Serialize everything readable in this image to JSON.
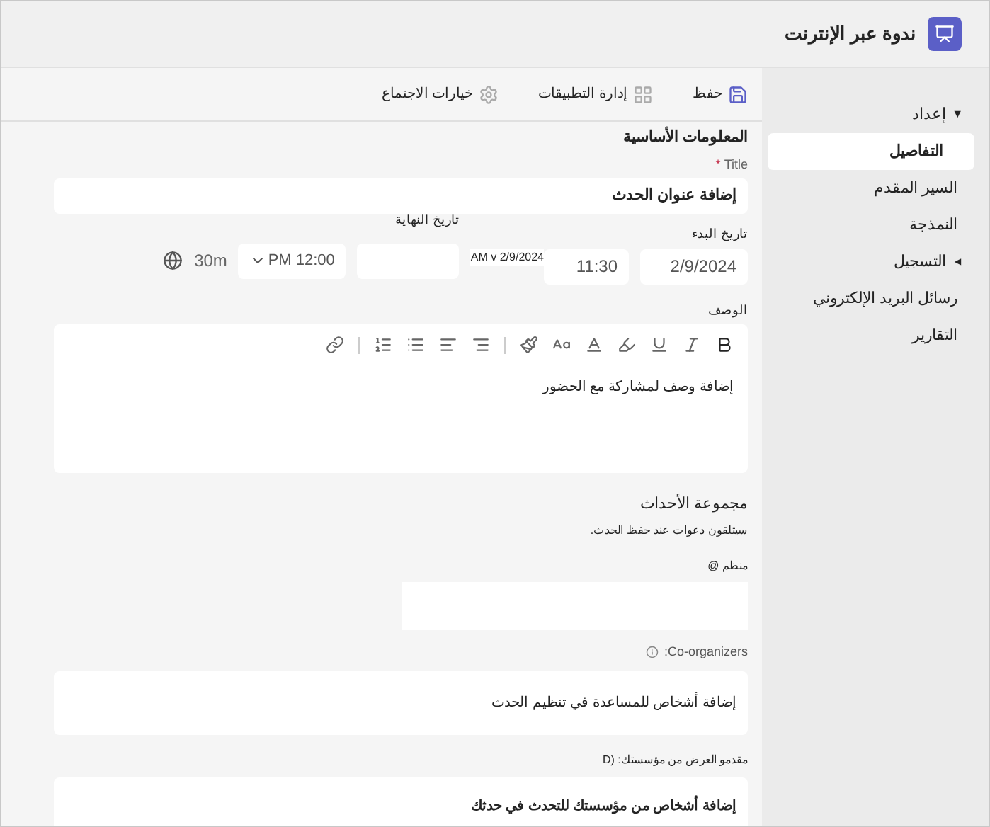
{
  "header": {
    "title": "ندوة عبر الإنترنت"
  },
  "sidebar": {
    "items": [
      {
        "label": "إعداد",
        "kind": "group",
        "caret": "▼",
        "expanded": true,
        "selected": false
      },
      {
        "label": "التفاصيل",
        "kind": "item",
        "selected": true
      },
      {
        "label": "السير المقدم",
        "kind": "item",
        "selected": false
      },
      {
        "label": "النمذجة",
        "kind": "item",
        "selected": false
      },
      {
        "label": "التسجيل",
        "kind": "group",
        "caret": "▼",
        "expanded": false,
        "selected": false
      },
      {
        "label": "رسائل البريد الإلكتروني",
        "kind": "item",
        "selected": false
      },
      {
        "label": "التقارير",
        "kind": "item",
        "selected": false
      }
    ]
  },
  "toolbar": [
    {
      "label": "حفظ",
      "kind": "save"
    },
    {
      "label": "إدارة التطبيقات",
      "kind": "apps"
    },
    {
      "label": "خيارات الاجتماع",
      "kind": "settings"
    }
  ],
  "section_title": "المعلومات الأساسية",
  "title_field": {
    "label": "Title",
    "required_mark": "*",
    "value": "إضافة عنوان الحدث"
  },
  "start": {
    "label": "تاريخ البدء",
    "date": "2/9/2024",
    "time": "11:30",
    "overlay": "AM v 2/9/2024"
  },
  "end": {
    "label": "تاريخ النهاية",
    "time": "12:00 PM",
    "duration": "30m"
  },
  "description": {
    "label": "الوصف",
    "placeholder": "إضافة وصف لمشاركة مع الحضور",
    "tools": [
      {
        "kind": "bold"
      },
      {
        "kind": "italic"
      },
      {
        "kind": "underline"
      },
      {
        "kind": "highlight"
      },
      {
        "kind": "font-color"
      },
      {
        "kind": "font-size"
      },
      {
        "kind": "style"
      },
      {
        "kind": "sep"
      },
      {
        "kind": "align-right"
      },
      {
        "kind": "align-left"
      },
      {
        "kind": "bullets"
      },
      {
        "kind": "numbers"
      },
      {
        "kind": "sep"
      },
      {
        "kind": "link"
      }
    ]
  },
  "group": {
    "title": "مجموعة الأحداث",
    "note": "سيتلقون دعوات عند حفظ الحدث."
  },
  "organizer": {
    "label": "منظم @"
  },
  "coorganizers": {
    "label": "Co-organizers:",
    "placeholder": "إضافة أشخاص للمساعدة في تنظيم الحدث"
  },
  "presenters": {
    "label": "مقدمو العرض من مؤسستك: (D",
    "placeholder": "إضافة أشخاص من مؤسستك للتحدث في حدثك"
  }
}
